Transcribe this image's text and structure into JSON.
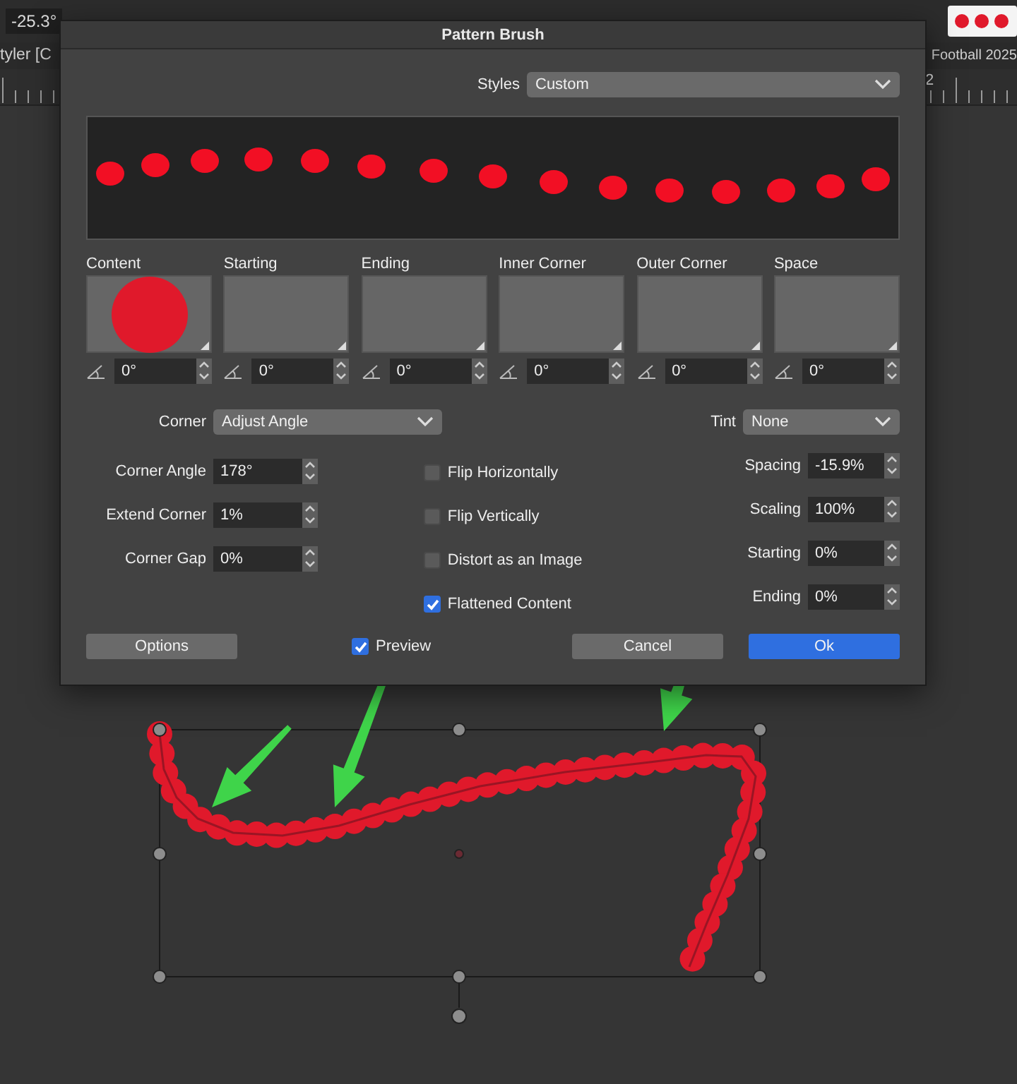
{
  "app": {
    "rotation": "-25.3°",
    "document_tabs": [
      {
        "label": "tyler [C"
      },
      {
        "label": "Football 2025"
      }
    ],
    "ruler_label": "2"
  },
  "dialog": {
    "title": "Pattern Brush",
    "styles": {
      "label": "Styles",
      "value": "Custom"
    },
    "slots": [
      {
        "label": "Content",
        "angle": "0°",
        "has_content": true
      },
      {
        "label": "Starting",
        "angle": "0°",
        "has_content": false
      },
      {
        "label": "Ending",
        "angle": "0°",
        "has_content": false
      },
      {
        "label": "Inner Corner",
        "angle": "0°",
        "has_content": false
      },
      {
        "label": "Outer Corner",
        "angle": "0°",
        "has_content": false
      },
      {
        "label": "Space",
        "angle": "0°",
        "has_content": false
      }
    ],
    "corner": {
      "label": "Corner",
      "value": "Adjust Angle"
    },
    "tint": {
      "label": "Tint",
      "value": "None"
    },
    "left_fields": [
      {
        "label": "Corner Angle",
        "value": "178°"
      },
      {
        "label": "Extend Corner",
        "value": "1%"
      },
      {
        "label": "Corner Gap",
        "value": "0%"
      }
    ],
    "checkboxes": [
      {
        "label": "Flip Horizontally",
        "checked": false
      },
      {
        "label": "Flip Vertically",
        "checked": false
      },
      {
        "label": "Distort as an Image",
        "checked": false
      },
      {
        "label": "Flattened Content",
        "checked": true
      }
    ],
    "right_fields": [
      {
        "label": "Spacing",
        "value": "-15.9%"
      },
      {
        "label": "Scaling",
        "value": "100%"
      },
      {
        "label": "Starting",
        "value": "0%"
      },
      {
        "label": "Ending",
        "value": "0%"
      }
    ],
    "options_button": {
      "label": "Options"
    },
    "preview": {
      "label": "Preview",
      "checked": true
    },
    "buttons": [
      {
        "label": "Cancel",
        "default": false
      },
      {
        "label": "Ok",
        "default": true
      }
    ]
  }
}
